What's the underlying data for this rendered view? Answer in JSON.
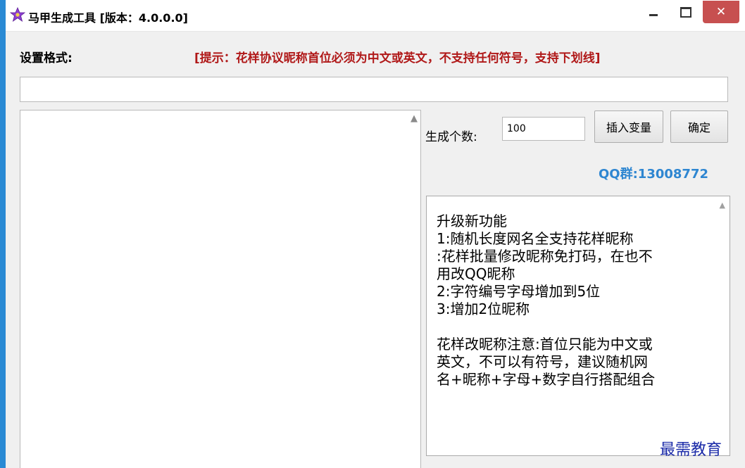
{
  "window": {
    "title": "马甲生成工具 [版本：4.0.0.0]",
    "controls": {
      "minimize": "–",
      "maximize": "□",
      "close": "✕"
    },
    "icon": "purple-star-icon"
  },
  "format": {
    "label": "设置格式:",
    "hint": "[提示：花样协议昵称首位必须为中文或英文，不支持任何符号，支持下划线]",
    "value": ""
  },
  "output": {
    "value": ""
  },
  "generate": {
    "count_label": "生成个数:",
    "count_value": "100",
    "insert_variable_label": "插入变量",
    "confirm_label": "确定"
  },
  "qq_group": "QQ群:13008772",
  "info": {
    "lines": [
      "升级新功能",
      "1:随机长度网名全支持花样昵称",
      ":花样批量修改昵称免打码，在也不",
      "用改QQ昵称",
      "2:字符编号字母增加到5位",
      "3:增加2位昵称",
      "",
      "花样改昵称注意:首位只能为中文或",
      "英文，不可以有符号，建议随机网",
      "名+昵称+字母+数字自行搭配组合"
    ]
  },
  "watermark": "最需教育",
  "colors": {
    "hint": "#b01818",
    "qq_group": "#2e86d1",
    "close_button": "#c75050",
    "watermark": "#1a2aa8"
  }
}
